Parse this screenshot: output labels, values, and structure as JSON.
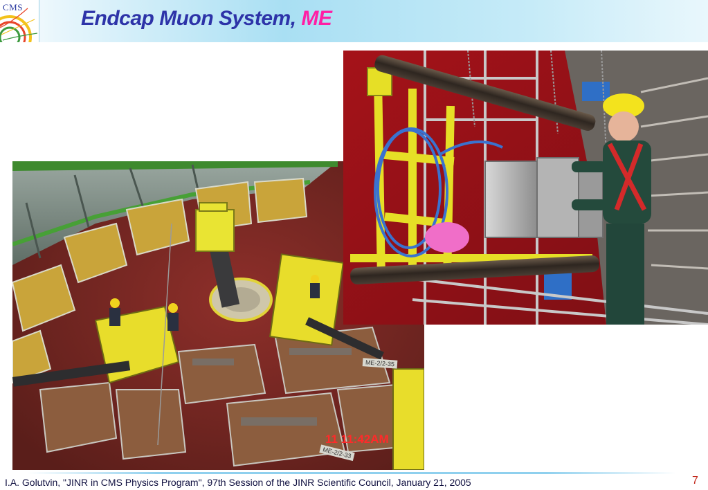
{
  "slide": {
    "title_main": "Endcap Muon System,",
    "title_accent": "ME",
    "logo_label": "CMS",
    "footer": "I.A. Golutvin, \"JINR in CMS Physics Program\", 97th Session of the JINR Scientific Council, January 21, 2005",
    "page_number": "7"
  },
  "photos": {
    "left": {
      "date_stamp": "11   11:42AM",
      "chamber_label_1": "ME-2/2-35",
      "chamber_label_2": "ME-2/2-33"
    }
  },
  "colors": {
    "title": "#2d33a8",
    "title_accent": "#ff1fa4",
    "footer_text": "#101040",
    "page_number": "#c2281c"
  }
}
